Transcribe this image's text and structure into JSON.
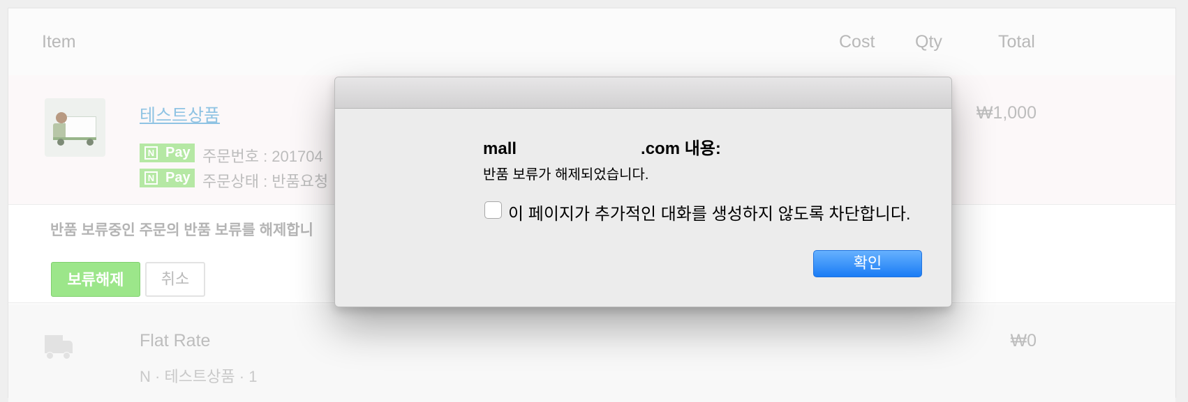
{
  "table": {
    "headers": {
      "item": "Item",
      "cost": "Cost",
      "qty": "Qty",
      "total": "Total"
    },
    "item": {
      "name": "테스트상품",
      "pay_badge_letter": "N",
      "pay_badge_text": "Pay",
      "order_number": "주문번호 : 201704",
      "order_status": "주문상태 : 반품요청",
      "total": "₩1,000"
    },
    "hold": {
      "message": "반품 보류중인 주문의 반품 보류를 해제합니",
      "release_button": "보류해제",
      "cancel_button": "취소"
    },
    "shipping": {
      "label": "Flat Rate",
      "total": "₩0",
      "cut_text": "N                      ·        테스트상품 · 1"
    }
  },
  "dialog": {
    "title_prefix": "mall",
    "title_suffix": ".com 내용:",
    "message": "반품 보류가 해제되었습니다.",
    "checkbox_label": "이 페이지가 추가적인 대화를 생성하지 않도록 차단합니다.",
    "checkbox_checked": false,
    "ok_button": "확인"
  },
  "colors": {
    "accent": "#1a7cf5",
    "npay_green": "#b5e8a4",
    "release_green": "#9ce68a"
  }
}
